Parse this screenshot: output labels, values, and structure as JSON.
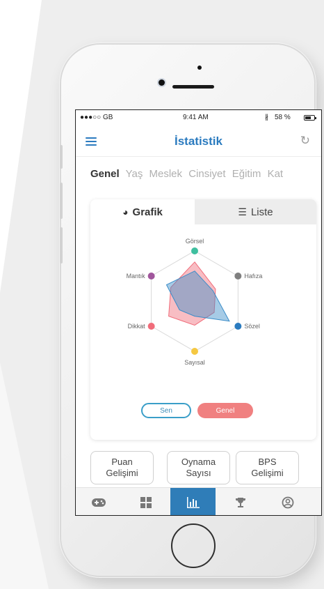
{
  "status_bar": {
    "carrier": "●●●○○ GB",
    "time": "9:41 AM",
    "battery": "58 %"
  },
  "navbar": {
    "title": "İstatistik"
  },
  "category_tabs": [
    "Genel",
    "Yaş",
    "Meslek",
    "Cinsiyet",
    "Eğitim",
    "Kat"
  ],
  "view_toggle": {
    "chart_label": "Grafik",
    "list_label": "Liste"
  },
  "radar": {
    "axes": [
      "Görsel",
      "Hafıza",
      "Sözel",
      "Sayısal",
      "Dikkat",
      "Mantık"
    ],
    "axis_colors": [
      "#3fbf9f",
      "#7f7f7f",
      "#2b7bbf",
      "#f5c842",
      "#f06c7a",
      "#a0569c"
    ],
    "series": [
      {
        "name": "Genel",
        "color": "#f06c7a",
        "values": [
          0.78,
          0.48,
          0.45,
          0.48,
          0.6,
          0.55
        ]
      },
      {
        "name": "Sen",
        "color": "#3a8cc8",
        "values": [
          0.6,
          0.42,
          0.8,
          0.3,
          0.35,
          0.65
        ]
      }
    ]
  },
  "legend": {
    "sen": "Sen",
    "genel": "Genel"
  },
  "stat_buttons": [
    {
      "line1": "Puan",
      "line2": "Gelişimi"
    },
    {
      "line1": "Oynama",
      "line2": "Sayısı"
    },
    {
      "line1": "BPS",
      "line2": "Gelişimi"
    }
  ],
  "tabbar": {
    "items": [
      "gamepad-icon",
      "grid-icon",
      "bar-chart-icon",
      "trophy-icon",
      "user-icon"
    ],
    "active": 2
  }
}
